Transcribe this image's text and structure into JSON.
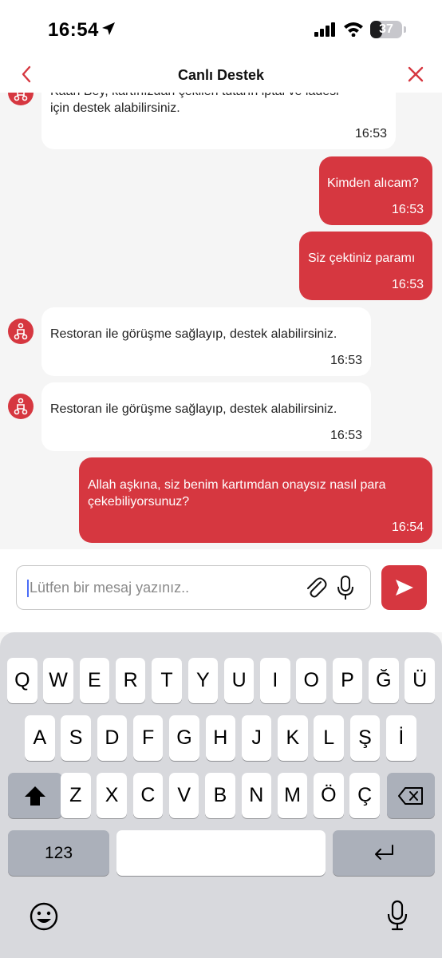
{
  "status_bar": {
    "time": "16:54",
    "battery": "37",
    "battery_level": 0.37
  },
  "header": {
    "title": "Canlı Destek",
    "back_icon": "chevron-left-icon",
    "close_icon": "close-icon"
  },
  "messages": [
    {
      "sender": "bot",
      "text_line1": "Kaan Bey, kartınızdan çekilen tutarın iptal ve iadesi",
      "text_line2": "için destek alabilirsiniz.",
      "time": "16:53"
    },
    {
      "sender": "user",
      "text": "Kimden alıcam?",
      "time": "16:53"
    },
    {
      "sender": "user",
      "text": "Siz çektiniz paramı",
      "time": "16:53"
    },
    {
      "sender": "bot",
      "text": "Restoran ile görüşme sağlayıp, destek alabilirsiniz.",
      "time": "16:53"
    },
    {
      "sender": "bot",
      "text": "Restoran ile görüşme sağlayıp, destek alabilirsiniz.",
      "time": "16:53"
    },
    {
      "sender": "user",
      "text_line1": "Allah aşkına, siz benim kartımdan onaysız nasıl para",
      "text_line2": "çekebiliyorsunuz?",
      "time": "16:54"
    }
  ],
  "composer": {
    "placeholder": "Lütfen bir mesaj yazınız.."
  },
  "keyboard": {
    "row1": [
      "Q",
      "W",
      "E",
      "R",
      "T",
      "Y",
      "U",
      "I",
      "O",
      "P",
      "Ğ",
      "Ü"
    ],
    "row2": [
      "A",
      "S",
      "D",
      "F",
      "G",
      "H",
      "J",
      "K",
      "L",
      "Ş",
      "İ"
    ],
    "row3": [
      "Z",
      "X",
      "C",
      "V",
      "B",
      "N",
      "M",
      "Ö",
      "Ç"
    ],
    "numbers_key": "123"
  },
  "colors": {
    "accent": "#d63740",
    "bot_bubble": "#ffffff",
    "background": "#f5f5f5",
    "keyboard_bg": "#d8d9dd"
  }
}
